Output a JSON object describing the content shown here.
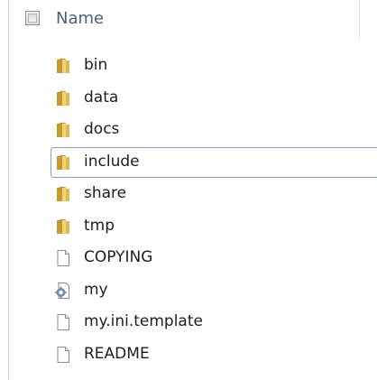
{
  "header": {
    "column_label": "Name"
  },
  "files": [
    {
      "name": "bin",
      "type": "folder",
      "icon": "folder-icon"
    },
    {
      "name": "data",
      "type": "folder",
      "icon": "folder-icon"
    },
    {
      "name": "docs",
      "type": "folder",
      "icon": "folder-icon"
    },
    {
      "name": "include",
      "type": "folder",
      "icon": "folder-icon",
      "selected": true
    },
    {
      "name": "share",
      "type": "folder",
      "icon": "folder-icon"
    },
    {
      "name": "tmp",
      "type": "folder",
      "icon": "folder-icon"
    },
    {
      "name": "COPYING",
      "type": "file",
      "icon": "document-icon"
    },
    {
      "name": "my",
      "type": "config",
      "icon": "config-file-icon"
    },
    {
      "name": "my.ini.template",
      "type": "file",
      "icon": "document-icon"
    },
    {
      "name": "README",
      "type": "file",
      "icon": "document-icon"
    }
  ],
  "colors": {
    "header_text": "#4c607a",
    "selection_border": "#7da2ce",
    "folder": "#e8c25c"
  }
}
